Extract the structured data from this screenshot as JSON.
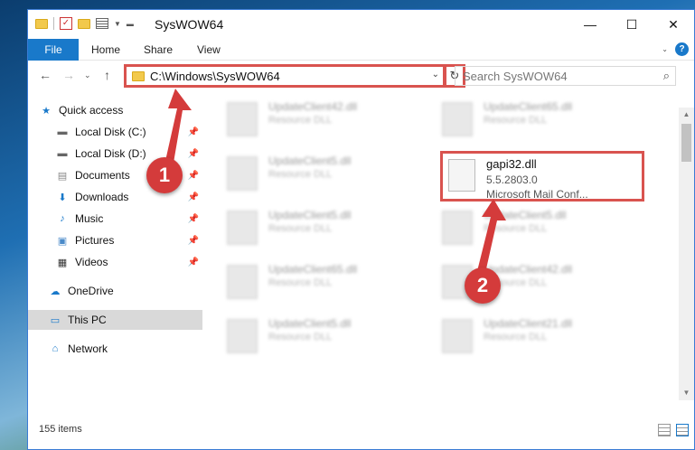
{
  "window": {
    "title": "SysWOW64",
    "controls": {
      "minimize": "—",
      "maximize": "☐",
      "close": "✕"
    }
  },
  "ribbon": {
    "tabs": [
      {
        "label": "File"
      },
      {
        "label": "Home"
      },
      {
        "label": "Share"
      },
      {
        "label": "View"
      }
    ],
    "help": "?"
  },
  "address": {
    "path": "C:\\Windows\\SysWOW64",
    "search_placeholder": "Search SysWOW64"
  },
  "nav": {
    "items": [
      {
        "label": "Quick access"
      },
      {
        "label": "Local Disk (C:)"
      },
      {
        "label": "Local Disk (D:)"
      },
      {
        "label": "Documents"
      },
      {
        "label": "Downloads"
      },
      {
        "label": "Music"
      },
      {
        "label": "Pictures"
      },
      {
        "label": "Videos"
      },
      {
        "label": "OneDrive"
      },
      {
        "label": "This PC"
      },
      {
        "label": "Network"
      }
    ]
  },
  "files": [
    {
      "name": "UpdateClient42.dll",
      "type": "Resource DLL"
    },
    {
      "name": "UpdateClient65.dll",
      "type": "Resource DLL"
    },
    {
      "name": "UpdateClient5.dll",
      "type": "Resource DLL"
    },
    {
      "name": "gapi32.dll",
      "version": "5.5.2803.0",
      "type": "Microsoft Mail Conf..."
    },
    {
      "name": "UpdateClient5.dll",
      "type": "Resource DLL"
    },
    {
      "name": "UpdateClient5.dll",
      "type": "Resource DLL"
    },
    {
      "name": "UpdateClient65.dll",
      "type": "Resource DLL"
    },
    {
      "name": "UpdateClient42.dll",
      "type": "Resource DLL"
    },
    {
      "name": "UpdateClient5.dll",
      "type": "Resource DLL"
    },
    {
      "name": "UpdateClient21.dll",
      "type": "Resource DLL"
    }
  ],
  "status": {
    "count": "155 items"
  },
  "badges": {
    "one": "1",
    "two": "2"
  },
  "colors": {
    "accent": "#1979ca",
    "highlight": "#d9534f"
  }
}
